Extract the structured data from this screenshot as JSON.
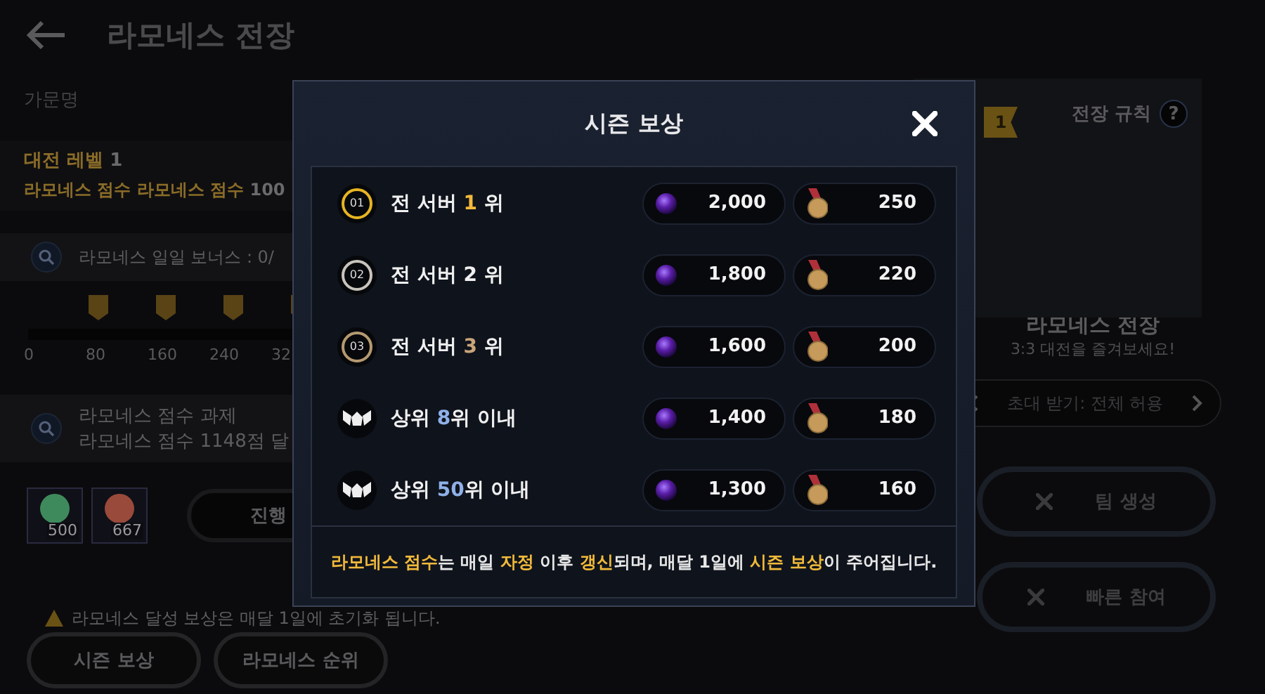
{
  "header": {
    "title": "라모네스 전장"
  },
  "family_label": "가문명",
  "level": {
    "label": "대전 레벨",
    "value": "1"
  },
  "score": {
    "label": "라모네스 점수 라모네스 점수",
    "value": "100"
  },
  "daily_bonus": {
    "text": "라모네스 일일 보너스 : 0/"
  },
  "progress": {
    "ticks": [
      "0",
      "80",
      "160",
      "240",
      "32"
    ]
  },
  "task": {
    "title": "라모네스 점수 과제",
    "description": "라모네스 점수 1148점 달"
  },
  "items": [
    {
      "count": "500",
      "color": "#3f8a5c"
    },
    {
      "count": "667",
      "color": "#9a4a3a"
    }
  ],
  "progress_button": "진행",
  "warning": "라모네스 달성 보상은 매달 1일에 초기화 됩니다.",
  "bottom_buttons": [
    "시즌 보상",
    "라모네스 순위"
  ],
  "side": {
    "rank": "1",
    "rules_label": "전장 규칙",
    "help": "?",
    "title": "라모네스 전장",
    "subtitle": "3:3 대전을 즐겨보세요!",
    "invite": "초대 받기: 전체 허용",
    "actions": [
      "팀 생성",
      "빠른 참여"
    ]
  },
  "modal": {
    "title": "시즌 보상",
    "rows": [
      {
        "badge": {
          "kind": "number",
          "text": "01",
          "color": "#e6b422"
        },
        "label": [
          {
            "text": "전 서버 "
          },
          {
            "text": "1",
            "color": "#f2b93b"
          },
          {
            "text": " 위"
          }
        ],
        "rewards": [
          {
            "kind": "gem",
            "amount": "2,000"
          },
          {
            "kind": "medal",
            "amount": "250"
          }
        ]
      },
      {
        "badge": {
          "kind": "number",
          "text": "02",
          "color": "#c8c4bc"
        },
        "label": [
          {
            "text": "전 서버 2 위"
          }
        ],
        "rewards": [
          {
            "kind": "gem",
            "amount": "1,800"
          },
          {
            "kind": "medal",
            "amount": "220"
          }
        ]
      },
      {
        "badge": {
          "kind": "number",
          "text": "03",
          "color": "#b59a70"
        },
        "label": [
          {
            "text": "전 서버 "
          },
          {
            "text": "3",
            "color": "#c9a57a"
          },
          {
            "text": " 위"
          }
        ],
        "rewards": [
          {
            "kind": "gem",
            "amount": "1,600"
          },
          {
            "kind": "medal",
            "amount": "200"
          }
        ]
      },
      {
        "badge": {
          "kind": "emblem"
        },
        "label": [
          {
            "text": "상위 "
          },
          {
            "text": "8",
            "color": "#8fb0e8"
          },
          {
            "text": "위 이내"
          }
        ],
        "rewards": [
          {
            "kind": "gem",
            "amount": "1,400"
          },
          {
            "kind": "medal",
            "amount": "180"
          }
        ]
      },
      {
        "badge": {
          "kind": "emblem"
        },
        "label": [
          {
            "text": "상위 "
          },
          {
            "text": "50",
            "color": "#8fb0e8"
          },
          {
            "text": "위 이내"
          }
        ],
        "rewards": [
          {
            "kind": "gem",
            "amount": "1,300"
          },
          {
            "kind": "medal",
            "amount": "160"
          }
        ]
      }
    ],
    "notice": [
      {
        "text": "라모네스 점수",
        "highlight": true
      },
      {
        "text": "는 매일 ",
        "highlight": false
      },
      {
        "text": "자정",
        "highlight": true
      },
      {
        "text": " 이후 ",
        "highlight": false
      },
      {
        "text": "갱신",
        "highlight": true
      },
      {
        "text": "되며, 매달 1일에 ",
        "highlight": false
      },
      {
        "text": "시즌 보상",
        "highlight": true
      },
      {
        "text": "이 주어집니다.",
        "highlight": false
      }
    ]
  }
}
